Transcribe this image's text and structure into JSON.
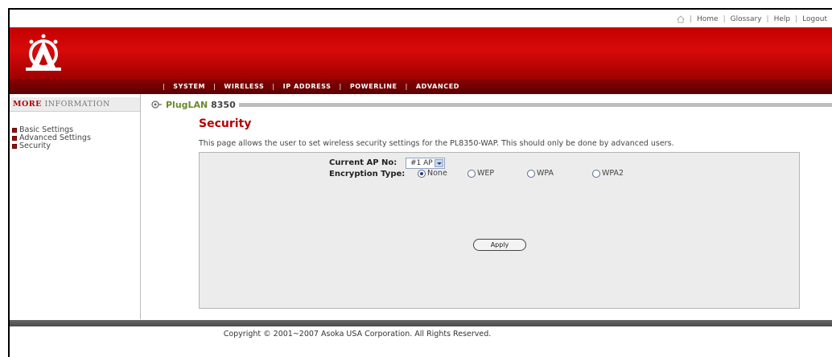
{
  "top_links": {
    "home": "Home",
    "glossary": "Glossary",
    "help": "Help",
    "logout": "Logout"
  },
  "nav": [
    "SYSTEM",
    "WIRELESS",
    "IP ADDRESS",
    "POWERLINE",
    "ADVANCED"
  ],
  "sidebar": {
    "header_more": "MORE",
    "header_info": "INFORMATION",
    "links": [
      "Basic Settings",
      "Advanced Settings",
      "Security"
    ]
  },
  "model": {
    "brand": "PlugLAN",
    "number": "8350"
  },
  "page": {
    "title": "Security",
    "description": "This page allows the user to set wireless security settings for the PL8350-WAP. This should only be done by advanced users."
  },
  "form": {
    "ap_label": "Current AP No:",
    "ap_value": "#1 AP",
    "enc_label": "Encryption Type:",
    "enc_options": [
      "None",
      "WEP",
      "WPA",
      "WPA2"
    ],
    "enc_selected": "None",
    "apply_label": "Apply"
  },
  "footer": {
    "copyright": "Copyright © 2001~2007 Asoka USA Corporation. All Rights Reserved."
  },
  "colors": {
    "banner": "#c40000",
    "navbar": "#7a0000",
    "title": "#b30000",
    "model_green": "#6a8a2a"
  }
}
